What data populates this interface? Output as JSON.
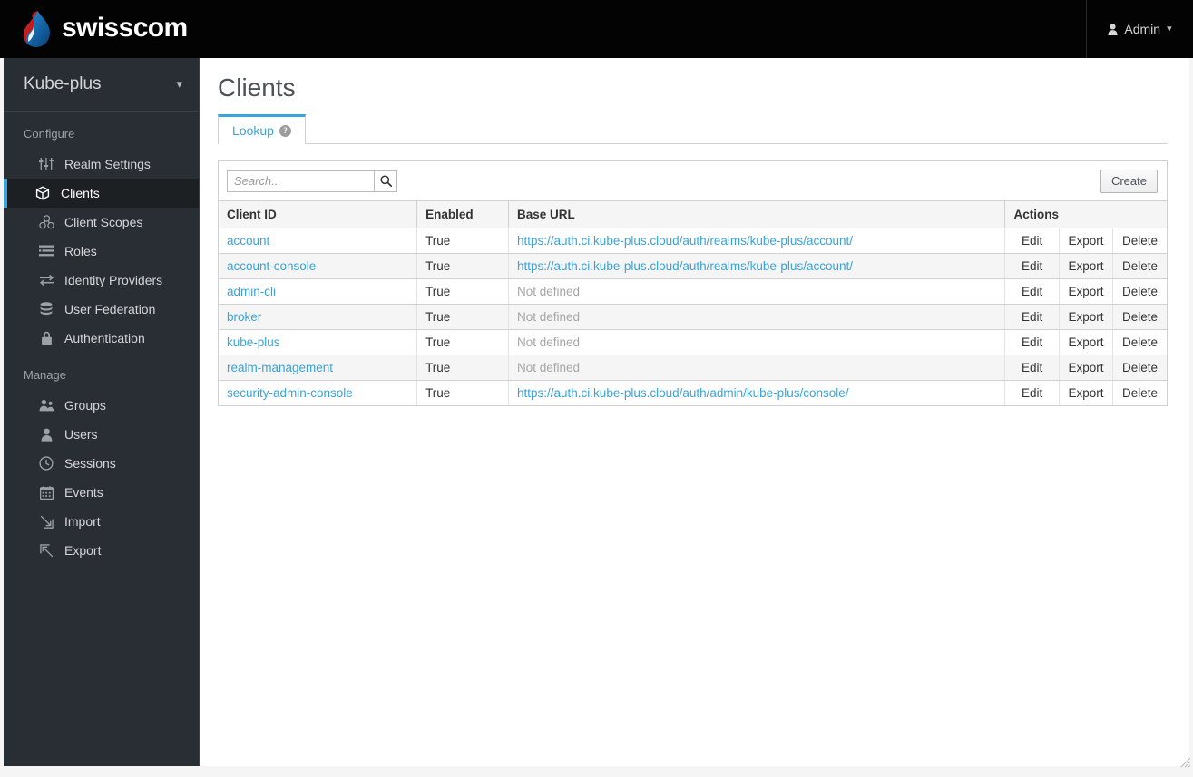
{
  "header": {
    "brand_name": "swisscom",
    "brand_logo_icon": "swisscom-droplet-logo",
    "user_icon": "user-icon",
    "user_label": "Admin",
    "caret_icon": "chevron-down-icon",
    "background_color": "#030303"
  },
  "sidebar": {
    "realm_name": "Kube-plus",
    "realm_caret_icon": "chevron-down-icon",
    "background_color": "#292e34",
    "active_accent_color": "#39a5dc",
    "groups": [
      {
        "title": "Configure",
        "items": [
          {
            "label": "Realm Settings",
            "icon": "sliders-icon",
            "active": false
          },
          {
            "label": "Clients",
            "icon": "cube-icon",
            "active": true
          },
          {
            "label": "Client Scopes",
            "icon": "cubes-icon",
            "active": false
          },
          {
            "label": "Roles",
            "icon": "list-bars-icon",
            "active": false
          },
          {
            "label": "Identity Providers",
            "icon": "exchange-arrows-icon",
            "active": false
          },
          {
            "label": "User Federation",
            "icon": "database-icon",
            "active": false
          },
          {
            "label": "Authentication",
            "icon": "lock-icon",
            "active": false
          }
        ]
      },
      {
        "title": "Manage",
        "items": [
          {
            "label": "Groups",
            "icon": "users-group-icon",
            "active": false
          },
          {
            "label": "Users",
            "icon": "user-icon",
            "active": false
          },
          {
            "label": "Sessions",
            "icon": "clock-icon",
            "active": false
          },
          {
            "label": "Events",
            "icon": "calendar-icon",
            "active": false
          },
          {
            "label": "Import",
            "icon": "arrow-into-box-icon",
            "active": false
          },
          {
            "label": "Export",
            "icon": "arrow-out-of-box-icon",
            "active": false
          }
        ]
      }
    ]
  },
  "main": {
    "page_title": "Clients",
    "tabs": [
      {
        "label": "Lookup",
        "help_icon": "question-circle-icon",
        "active": true
      }
    ],
    "toolbar": {
      "search_placeholder": "Search...",
      "search_value": "",
      "search_icon": "search-icon",
      "create_label": "Create"
    },
    "table": {
      "columns": [
        "Client ID",
        "Enabled",
        "Base URL",
        "Actions"
      ],
      "action_labels": [
        "Edit",
        "Export",
        "Delete"
      ],
      "not_defined_text": "Not defined",
      "rows": [
        {
          "client_id": "account",
          "enabled": "True",
          "base_url": "https://auth.ci.kube-plus.cloud/auth/realms/kube-plus/account/",
          "url_defined": true
        },
        {
          "client_id": "account-console",
          "enabled": "True",
          "base_url": "https://auth.ci.kube-plus.cloud/auth/realms/kube-plus/account/",
          "url_defined": true
        },
        {
          "client_id": "admin-cli",
          "enabled": "True",
          "base_url": "Not defined",
          "url_defined": false
        },
        {
          "client_id": "broker",
          "enabled": "True",
          "base_url": "Not defined",
          "url_defined": false
        },
        {
          "client_id": "kube-plus",
          "enabled": "True",
          "base_url": "Not defined",
          "url_defined": false
        },
        {
          "client_id": "realm-management",
          "enabled": "True",
          "base_url": "Not defined",
          "url_defined": false
        },
        {
          "client_id": "security-admin-console",
          "enabled": "True",
          "base_url": "https://auth.ci.kube-plus.cloud/auth/admin/kube-plus/console/",
          "url_defined": true
        }
      ]
    }
  },
  "window": {
    "resize_handle_icon": "resize-grip-icon"
  }
}
